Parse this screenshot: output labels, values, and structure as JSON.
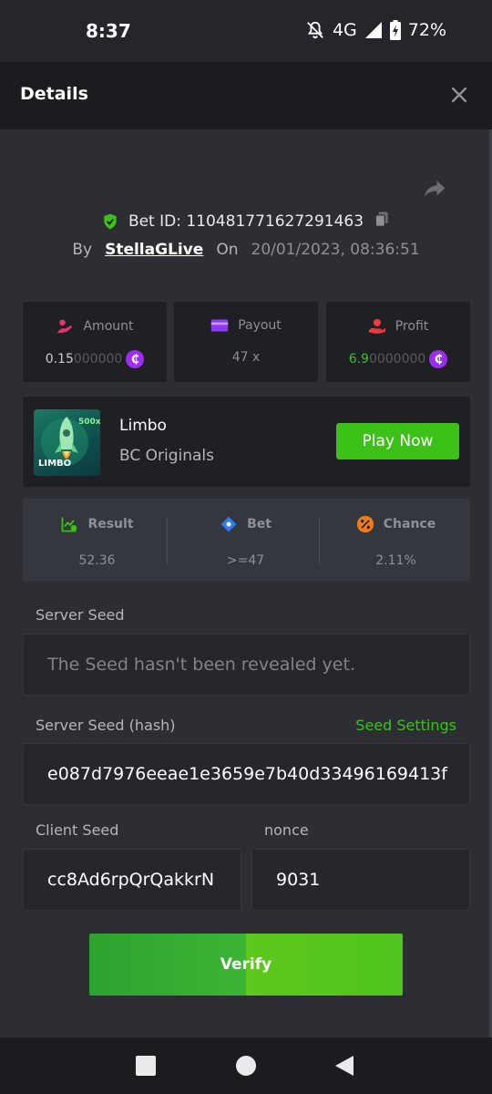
{
  "status_bar": {
    "time": "8:37",
    "network": "4G",
    "battery": "72%"
  },
  "header": {
    "title": "Details"
  },
  "bet": {
    "id_text": "Bet ID: 110481771627291463",
    "by_label": "By",
    "user": "StellaGLive",
    "on_label": "On",
    "date": "20/01/2023, 08:36:51"
  },
  "stats": {
    "amount": {
      "label": "Amount",
      "value_main": "0.15",
      "value_dim": "000000",
      "coin": "₵"
    },
    "payout": {
      "label": "Payout",
      "value": "47 x"
    },
    "profit": {
      "label": "Profit",
      "value_main": "6.9",
      "value_dim": "0000000",
      "coin": "₵"
    }
  },
  "game": {
    "name": "Limbo",
    "provider": "BC Originals",
    "thumb_badge": "500x",
    "thumb_label": "LIMBO",
    "play_label": "Play Now"
  },
  "result": {
    "result": {
      "label": "Result",
      "value": "52.36"
    },
    "bet": {
      "label": "Bet",
      "value": ">=47"
    },
    "chance": {
      "label": "Chance",
      "value": "2.11%"
    }
  },
  "fields": {
    "server_seed_label": "Server Seed",
    "server_seed_placeholder": "The Seed hasn't been revealed yet.",
    "server_seed_hash_label": "Server Seed (hash)",
    "seed_settings_label": "Seed Settings",
    "server_seed_hash": "e087d7976eeae1e3659e7b40d33496169413f",
    "client_seed_label": "Client Seed",
    "client_seed": "cc8Ad6rpQrQakkrN",
    "nonce_label": "nonce",
    "nonce": "9031"
  },
  "verify_label": "Verify",
  "colors": {
    "accent_green": "#3bc117",
    "coin_purple": "#9d2cf2",
    "panel_dark": "#1e2024",
    "background": "#2c2e33"
  },
  "icons": [
    "mute-icon",
    "signal-icon",
    "battery-icon",
    "close-icon",
    "share-icon",
    "shield-check-icon",
    "copy-icon",
    "amount-icon",
    "payout-icon",
    "profit-icon",
    "coin-icon",
    "rocket-icon",
    "result-icon",
    "bet-icon",
    "percent-icon",
    "nav-square-icon",
    "nav-home-icon",
    "nav-back-icon"
  ]
}
